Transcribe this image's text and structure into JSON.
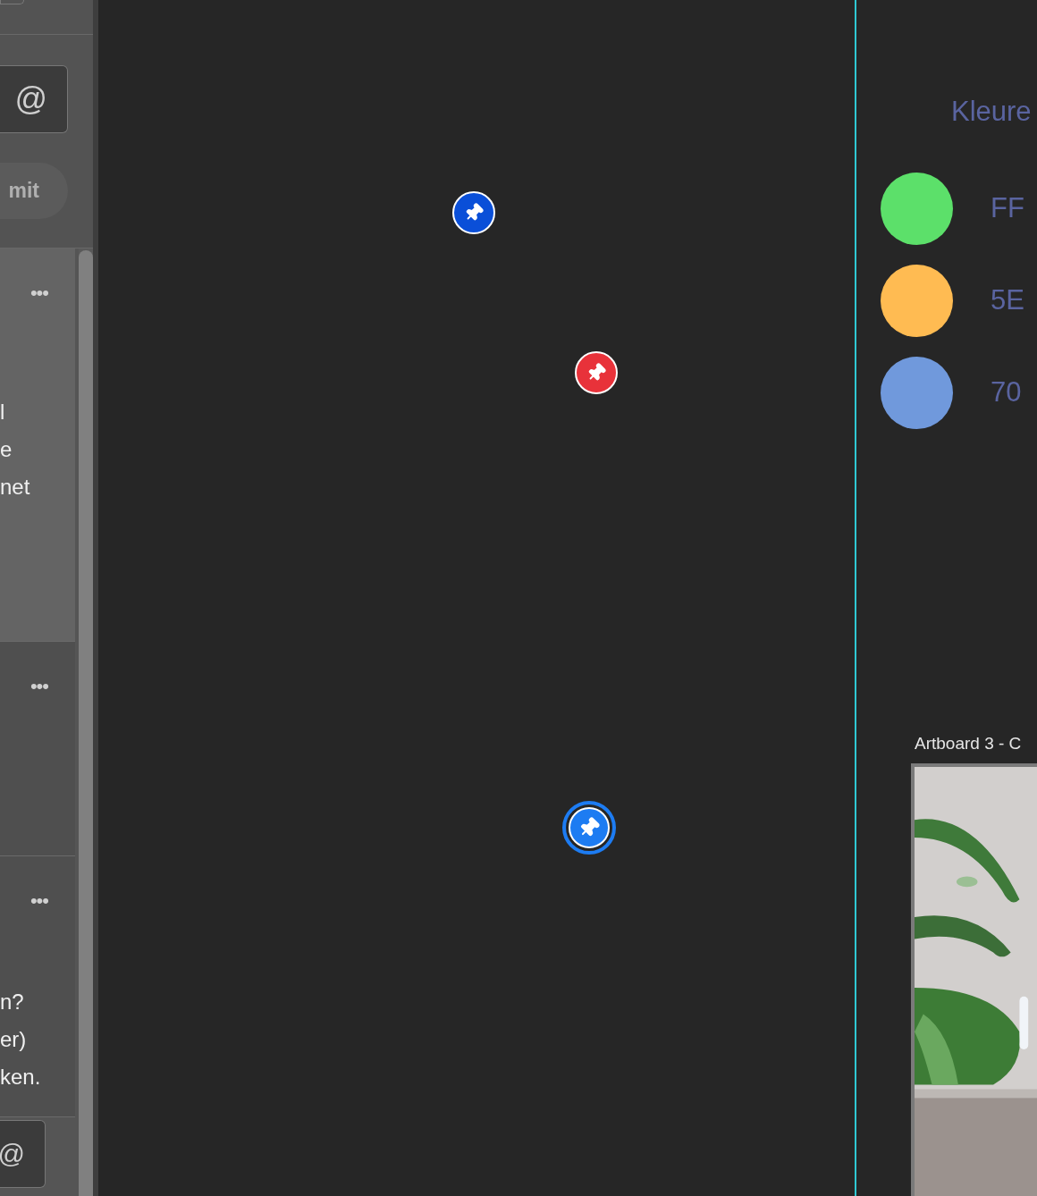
{
  "comments_panel": {
    "comment_input": {
      "mention": "@"
    },
    "submit_button": "mit",
    "comments": [
      {
        "selected": true,
        "more": "•••",
        "lines": [
          "l",
          "e",
          "net"
        ]
      },
      {
        "selected": false,
        "more": "•••"
      },
      {
        "selected": false,
        "more": "•••",
        "lines": [
          "n?",
          "er)",
          "ken."
        ]
      }
    ],
    "reply_input": {
      "mention": "@"
    }
  },
  "canvas": {
    "pins": [
      {
        "color": "#0a4fd8",
        "selected": false
      },
      {
        "color": "#e8323a",
        "selected": false
      },
      {
        "color": "#1d7cf2",
        "selected": true
      }
    ],
    "artboard": {
      "heading": "Kleure",
      "swatches": [
        {
          "color": "#5ce06a",
          "code": "FF"
        },
        {
          "color": "#ffbb52",
          "code": "5E"
        },
        {
          "color": "#7099dc",
          "code": "70"
        }
      ]
    },
    "artboard_label": "Artboard 3 - C"
  }
}
